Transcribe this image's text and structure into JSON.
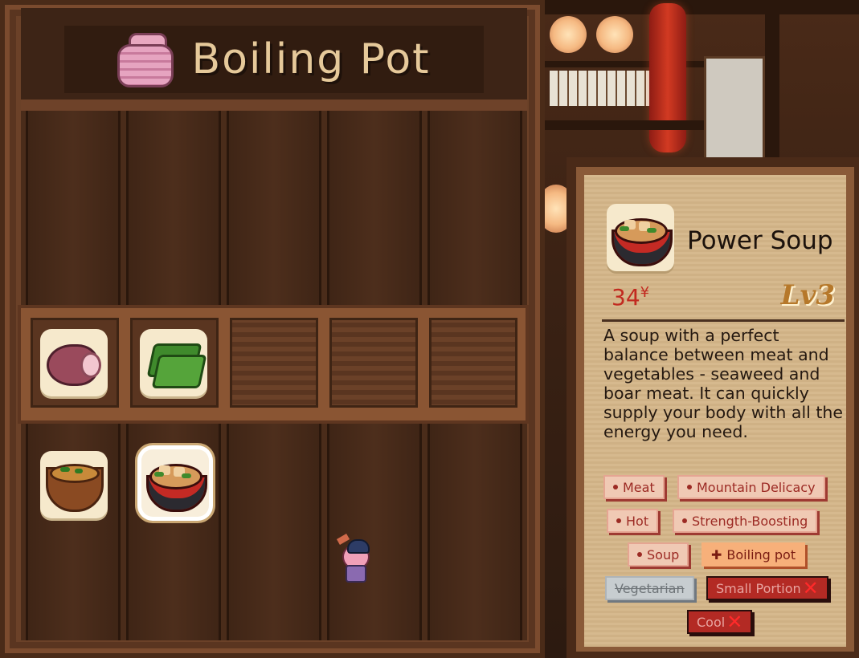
{
  "pot_panel": {
    "title": "Boiling Pot",
    "ingredients": [
      {
        "name": "boar-meat-icon"
      },
      {
        "name": "seaweed-icon"
      }
    ],
    "dishes": [
      {
        "name": "miso-soup-icon"
      },
      {
        "name": "power-soup-icon",
        "selected": true
      }
    ]
  },
  "info_card": {
    "dish_name": "Power Soup",
    "price": "34",
    "currency": "¥",
    "level": "Lv3",
    "description": "A soup with a perfect balance between meat and vegetables - seaweed and boar meat. It can quickly supply your body with all the energy you need.",
    "tags": {
      "meat": "Meat",
      "mountain_delicacy": "Mountain Delicacy",
      "hot": "Hot",
      "strength_boosting": "Strength-Boosting",
      "soup": "Soup",
      "boiling_pot": "Boiling pot",
      "vegetarian": "Vegetarian",
      "small_portion": "Small Portion",
      "cool": "Cool"
    }
  },
  "colors": {
    "title_text": "#e6c99a",
    "price": "#c22a20",
    "level": "#b6782a",
    "tag_bg": "#f0c9b4",
    "tag_text": "#9c2a24",
    "pot_tag_bg": "#f7b07a",
    "negative_tag_bg": "#b32a24"
  }
}
